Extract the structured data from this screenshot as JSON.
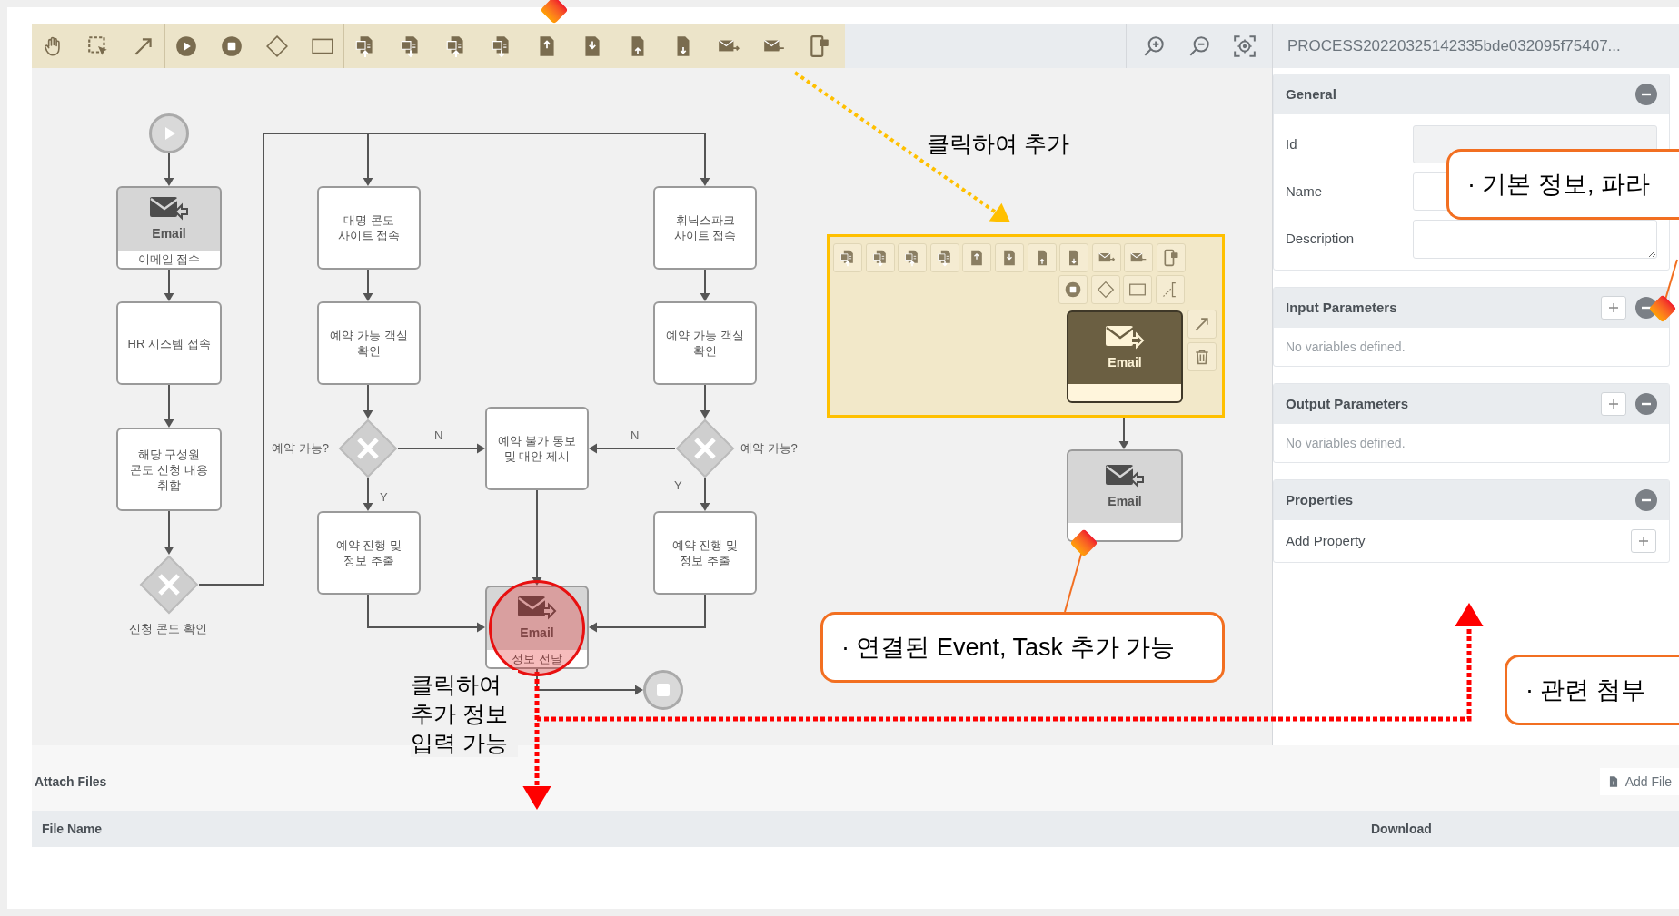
{
  "toolbar": {
    "process_title": "PROCESS20220325142335bde032095f75407..."
  },
  "diagram": {
    "nodes": [
      {
        "kind": "start"
      },
      {
        "kind": "email_receive",
        "title": "Email",
        "label": "이메일 접수",
        "highlighted": false
      },
      {
        "kind": "task",
        "label": "HR 시스템 접속"
      },
      {
        "kind": "task",
        "label": "해당 구성원\n콘도 신청 내용\n취합"
      },
      {
        "kind": "gateway",
        "label": "신청 콘도 확인"
      },
      {
        "kind": "task",
        "label": "대명 콘도\n사이트 접속"
      },
      {
        "kind": "task",
        "label": "예약 가능 객실\n확인"
      },
      {
        "kind": "gateway",
        "label": "예약 가능?"
      },
      {
        "kind": "task",
        "label": "예약 진행 및\n정보 추출"
      },
      {
        "kind": "task",
        "label": "예약 불가 통보\n및 대안 제시"
      },
      {
        "kind": "task",
        "label": "휘닉스파크\n사이트 접속"
      },
      {
        "kind": "task",
        "label": "예약 가능 객실\n확인"
      },
      {
        "kind": "gateway",
        "label": "예약 가능?"
      },
      {
        "kind": "task",
        "label": "예약 진행 및\n정보 추출"
      },
      {
        "kind": "email_send",
        "title": "Email",
        "label": "정보 전달",
        "highlighted": true
      },
      {
        "kind": "end"
      }
    ],
    "edge_labels": [
      {
        "text": "N"
      },
      {
        "text": "Y"
      },
      {
        "text": "N"
      },
      {
        "text": "Y"
      }
    ]
  },
  "popup": {
    "node": {
      "title": "Email",
      "selected": true
    },
    "next_node": {
      "title": "Email",
      "selected": false
    }
  },
  "hints": [
    {
      "text": "클릭하여 추가"
    },
    {
      "text": "클릭하여 추가 정보 입력 가능"
    }
  ],
  "callouts": [
    {
      "text": "· 연결된 Event, Task 추가 가능"
    },
    {
      "text": "· 기본 정보, 파라"
    },
    {
      "text": "· 관련 첨부"
    }
  ],
  "panel": {
    "sections": [
      {
        "kind": "form",
        "title": "General",
        "expanded": true,
        "addable": false,
        "fields": [
          {
            "kind": "text",
            "label": "Id",
            "disabled": true
          },
          {
            "kind": "text",
            "label": "Name",
            "disabled": false
          },
          {
            "kind": "textarea",
            "label": "Description",
            "disabled": false
          }
        ]
      },
      {
        "kind": "list",
        "title": "Input Parameters",
        "expanded": true,
        "addable": true,
        "empty_text": "No variables defined."
      },
      {
        "kind": "list",
        "title": "Output Parameters",
        "expanded": true,
        "addable": true,
        "empty_text": "No variables defined."
      },
      {
        "kind": "properties",
        "title": "Properties",
        "expanded": true,
        "addable": false,
        "add_label": "Add Property"
      }
    ]
  },
  "attach": {
    "title": "Attach Files",
    "add_button": "Add File",
    "columns": [
      "File Name",
      "Download"
    ]
  }
}
